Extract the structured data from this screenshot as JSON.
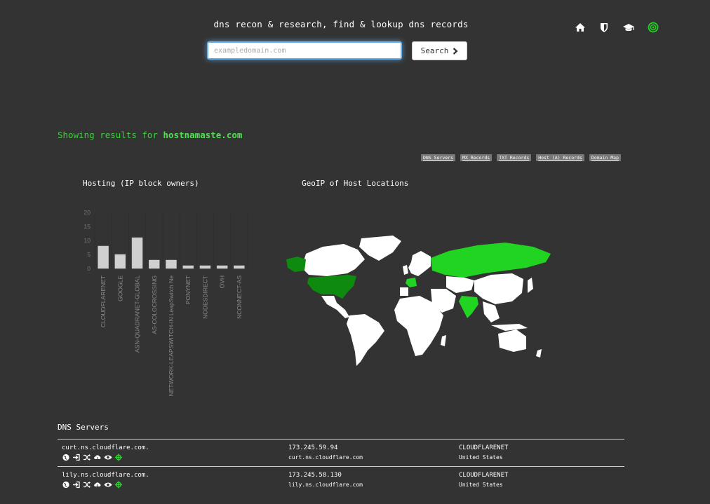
{
  "header": {
    "title": "dns recon & research, find & lookup dns records",
    "nav_icons": [
      "home-icon",
      "shield-icon",
      "graduation-cap-icon",
      "target-icon"
    ]
  },
  "search": {
    "placeholder": "exampledomain.com",
    "button_label": "Search"
  },
  "results": {
    "prefix": "Showing results for ",
    "domain": "hostnamaste.com"
  },
  "jump_links": [
    "DNS Servers",
    "MX Records",
    "TXT Records",
    "Host (A) Records",
    "Domain Map"
  ],
  "hosting": {
    "title": "Hosting (IP block owners)",
    "chart_data": {
      "type": "bar",
      "categories": [
        "CLOUDFLARENET",
        "GOOGLE",
        "ASN-QUADRANET-GLOBAL",
        "AS-COLOCROSSING",
        "NETWORK-LEAPSWITCH-IN LeapSwitch Ne",
        "PONYNET",
        "NODESDIRECT",
        "OVH",
        "NCONNECT-AS"
      ],
      "values": [
        8,
        5,
        11,
        3,
        3,
        1,
        1,
        1,
        1
      ],
      "ylim": [
        0,
        20
      ],
      "yticks": [
        0,
        5,
        10,
        15,
        20
      ],
      "grid": true
    }
  },
  "geoip": {
    "title": "GeoIP of Host Locations",
    "highlighted_countries": [
      "United States",
      "Russia",
      "India",
      "France",
      "Canada"
    ],
    "colors": {
      "land": "#ffffff",
      "dark_highlight": "#0e8a0e",
      "bright_highlight": "#22d422"
    }
  },
  "dns_servers": {
    "heading": "DNS Servers",
    "action_icons": [
      "globe-icon",
      "sign-in-icon",
      "random-icon",
      "cloud-download-icon",
      "eye-icon",
      "crosshairs-icon"
    ],
    "rows": [
      {
        "host": "curt.ns.cloudflare.com.",
        "ip": "173.245.59.94",
        "reverse": "curt.ns.cloudflare.com",
        "asn": "CLOUDFLARENET",
        "country": "United States"
      },
      {
        "host": "lily.ns.cloudflare.com.",
        "ip": "173.245.58.130",
        "reverse": "lily.ns.cloudflare.com",
        "asn": "CLOUDFLARENET",
        "country": "United States"
      }
    ]
  }
}
